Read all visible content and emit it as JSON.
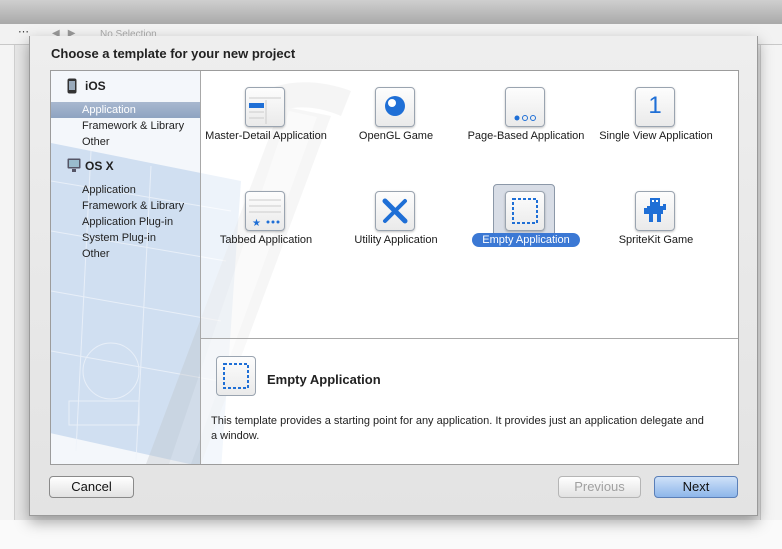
{
  "background": {
    "toolbar_status": "No Selection"
  },
  "dialog": {
    "title": "Choose a template for your new project"
  },
  "sidebar": {
    "sections": [
      {
        "label": "iOS",
        "icon": "iphone-icon",
        "items": [
          "Application",
          "Framework & Library",
          "Other"
        ],
        "selected_index": 0
      },
      {
        "label": "OS X",
        "icon": "mac-icon",
        "items": [
          "Application",
          "Framework & Library",
          "Application Plug-in",
          "System Plug-in",
          "Other"
        ]
      }
    ]
  },
  "templates": [
    {
      "label": "Master-Detail Application",
      "icon": "master-detail-icon"
    },
    {
      "label": "OpenGL Game",
      "icon": "opengl-game-icon"
    },
    {
      "label": "Page-Based Application",
      "icon": "page-based-icon"
    },
    {
      "label": "Single View Application",
      "icon": "single-view-icon",
      "glyph": "1"
    },
    {
      "label": "Tabbed Application",
      "icon": "tabbed-icon"
    },
    {
      "label": "Utility Application",
      "icon": "utility-icon"
    },
    {
      "label": "Empty Application",
      "icon": "empty-app-icon",
      "selected": true
    },
    {
      "label": "SpriteKit Game",
      "icon": "spritekit-icon"
    }
  ],
  "detail": {
    "title": "Empty Application",
    "description": "This template provides a starting point for any application. It provides just an application delegate and a window."
  },
  "buttons": {
    "cancel": "Cancel",
    "previous": "Previous",
    "next": "Next"
  },
  "colors": {
    "selection_accent": "#3b78d4",
    "icon_blue": "#1f6fd6"
  }
}
